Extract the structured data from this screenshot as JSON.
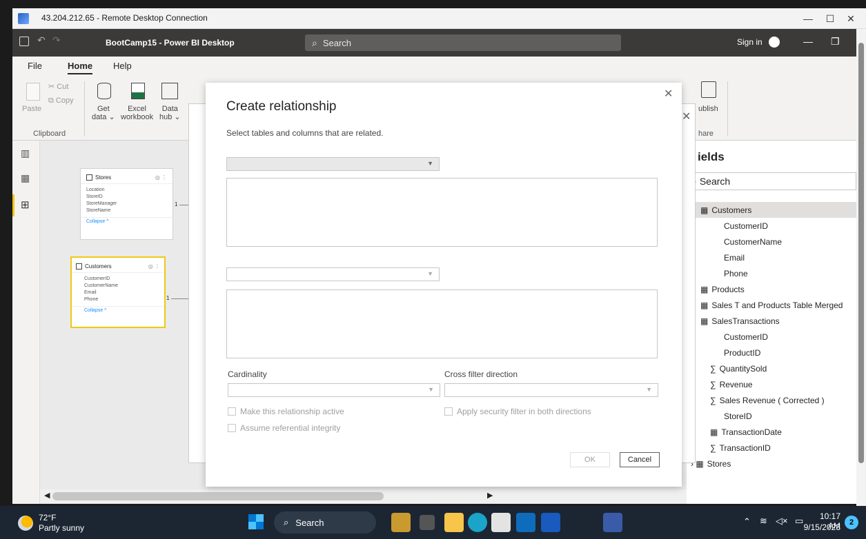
{
  "rdp": {
    "title": "43.204.212.65 - Remote Desktop Connection",
    "minimize": "—",
    "maximize": "☐",
    "close": "✕"
  },
  "pbi": {
    "doc_title": "BootCamp15 - Power BI Desktop",
    "search_placeholder": "Search",
    "sign_in": "Sign in",
    "min": "—",
    "restore": "❐"
  },
  "menu": {
    "file": "File",
    "home": "Home",
    "help": "Help"
  },
  "ribbon": {
    "paste": "Paste",
    "cut": "Cut",
    "copy": "Copy",
    "clipboard": "Clipboard",
    "get_data_1": "Get",
    "get_data_2": "data ⌄",
    "excel_1": "Excel",
    "excel_2": "workbook",
    "datahub_1": "Data",
    "datahub_2": "hub ⌄",
    "publish": "ublish",
    "share": "hare"
  },
  "model": {
    "stores": {
      "name": "Stores",
      "fields": [
        "Location",
        "StoreID",
        "StoreManager",
        "StoreName"
      ],
      "collapse": "Collapse ^",
      "one": "1"
    },
    "customers": {
      "name": "Customers",
      "fields": [
        "CustomerID",
        "CustomerName",
        "Email",
        "Phone"
      ],
      "collapse": "Collapse ^",
      "one": "1"
    }
  },
  "fields": {
    "header": "ields",
    "search_placeholder": "Search",
    "items": [
      {
        "label": "Customers",
        "type": "table"
      },
      {
        "label": "CustomerID",
        "type": "field"
      },
      {
        "label": "CustomerName",
        "type": "field"
      },
      {
        "label": "Email",
        "type": "field"
      },
      {
        "label": "Phone",
        "type": "field"
      },
      {
        "label": "Products",
        "type": "table"
      },
      {
        "label": "Sales T and Products Table Merged",
        "type": "table"
      },
      {
        "label": "SalesTransactions",
        "type": "table"
      },
      {
        "label": "CustomerID",
        "type": "field"
      },
      {
        "label": "ProductID",
        "type": "field"
      },
      {
        "label": "QuantitySold",
        "type": "sum"
      },
      {
        "label": "Revenue",
        "type": "sum"
      },
      {
        "label": "Sales Revenue ( Corrected )",
        "type": "sum"
      },
      {
        "label": "StoreID",
        "type": "field"
      },
      {
        "label": "TransactionDate",
        "type": "date"
      },
      {
        "label": "TransactionID",
        "type": "sum"
      },
      {
        "label": "Stores",
        "type": "table-collapsed"
      }
    ]
  },
  "dialog": {
    "title": "Create relationship",
    "subtitle": "Select tables and columns that are related.",
    "cardinality": "Cardinality",
    "cross_filter": "Cross filter direction",
    "make_active": "Make this relationship active",
    "apply_security": "Apply security filter in both directions",
    "referential": "Assume referential integrity",
    "ok": "OK",
    "cancel": "Cancel",
    "close": "✕"
  },
  "taskbar": {
    "temp": "72°F",
    "weather": "Partly sunny",
    "search": "Search",
    "time": "10:17 AM",
    "date": "9/15/2023",
    "badge": "2"
  }
}
